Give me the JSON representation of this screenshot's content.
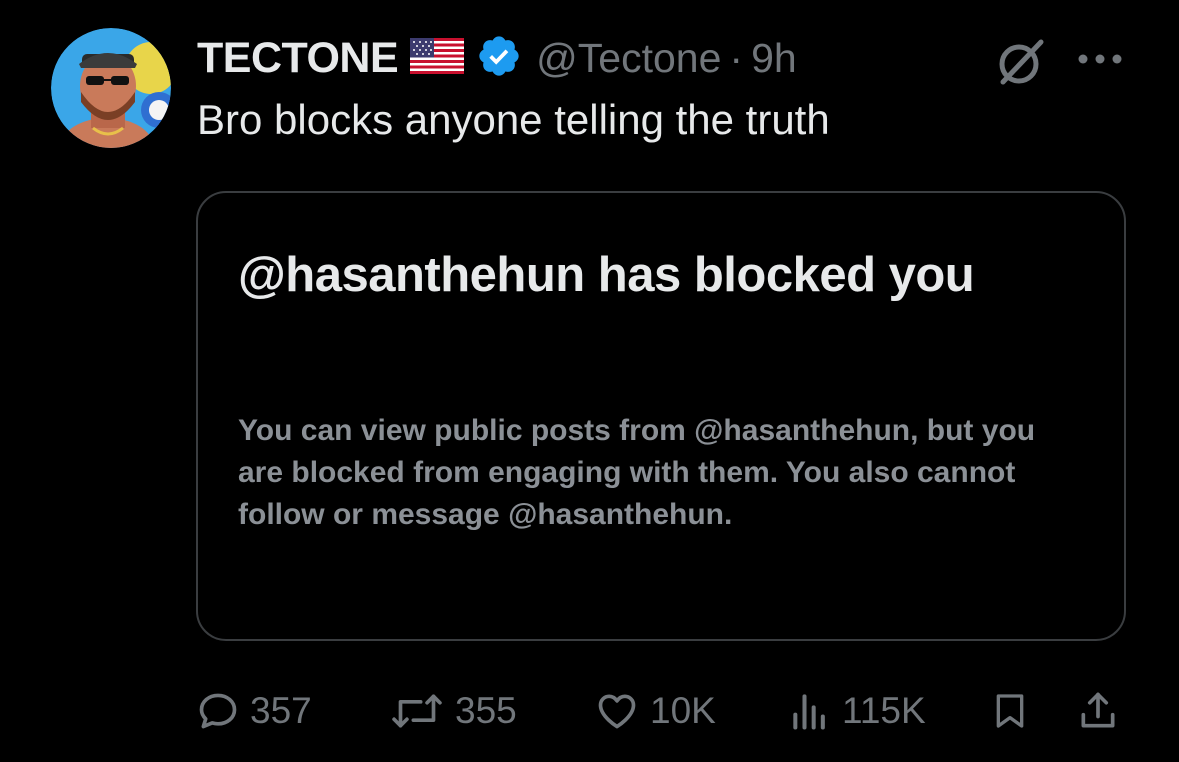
{
  "tweet": {
    "display_name": "TECTONE",
    "handle": "@Tectone",
    "separator": "·",
    "time": "9h",
    "text": "Bro blocks anyone telling the truth",
    "icons": {
      "flag": "us-flag-icon",
      "verified": "verified-badge-icon",
      "grok": "grok-icon",
      "more": "more-options-icon"
    }
  },
  "embedded_card": {
    "title": "@hasanthehun has blocked you",
    "description": "You can view public posts from @hasanthehun, but you are blocked from engaging with them. You also cannot follow or message @hasanthehun."
  },
  "actions": {
    "replies": "357",
    "reposts": "355",
    "likes": "10K",
    "views": "115K"
  },
  "colors": {
    "background": "#000000",
    "text_primary": "#e7e9ea",
    "text_secondary": "#71767b",
    "verified_blue": "#1d9bf0",
    "card_border": "#3a3d40"
  }
}
